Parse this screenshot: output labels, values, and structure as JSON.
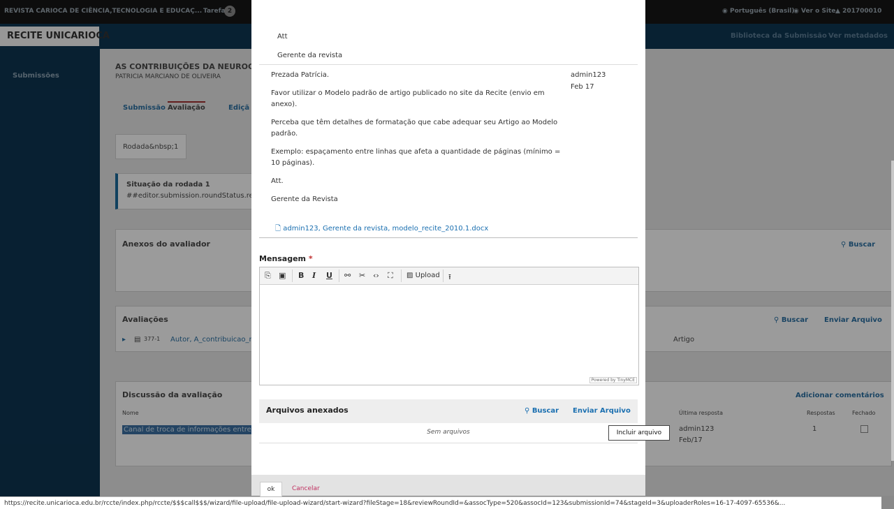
{
  "topbar": {
    "journal": "REVISTA CARIOCA DE CIÊNCIA,TECNOLOGIA E EDUCAÇ...",
    "tasks_label": "Tarefas",
    "tasks_count": "2",
    "language": "Português (Brasil)",
    "view_site": "Ver o Site",
    "user": "201700010"
  },
  "nav": {
    "library": "Biblioteca da Submissão",
    "metadata": "Ver metadados"
  },
  "logo": {
    "text": "RECITE UNICARIOCA"
  },
  "sidebar": {
    "submissions": "Submissões"
  },
  "background": {
    "title": "AS CONTRIBUIÇÕES DA NEUROCIÊN",
    "author": "PATRICIA MARCIANO DE OLIVEIRA",
    "tabs": [
      "Submissão",
      "Avaliação",
      "Ediçã"
    ],
    "round_tab": "Rodada&nbsp;1",
    "round_status_title": "Situação da rodada 1",
    "round_status_text": "##editor.submission.roundStatus.revi",
    "reviewer_attachments": "Anexos do avaliador",
    "search": "Buscar",
    "reviews": "Avaliações",
    "reviews_search": "Buscar",
    "reviews_upload": "Enviar Arquivo",
    "file_id": "377-1",
    "file_name": "Autor, A_contribuicao_ne",
    "file_type": "Artigo",
    "discussion": "Discussão da avaliação",
    "add_comments": "Adicionar comentários",
    "col_name": "Nome",
    "col_last_reply": "Última resposta",
    "col_replies": "Respostas",
    "col_closed": "Fechado",
    "discussion_row": "Canal de troca de informações entre Au",
    "row_reply_user": "admin123",
    "row_reply_date": "Feb/17",
    "row_replies": "1"
  },
  "modal": {
    "prev_message": {
      "line1": "Att",
      "line2": "Gerente da revista"
    },
    "message": {
      "paragraphs": [
        "Prezada Patrícia.",
        "Favor utilizar o Modelo padrão de artigo publicado no site da Recite (envio em anexo).",
        "Perceba que têm detalhes de formatação que cabe adequar seu Artigo ao Modelo padrão.",
        "Exemplo: espaçamento entre linhas que afeta a quantidade de páginas (mínimo = 10 páginas).",
        "Att.",
        "Gerente da Revista"
      ],
      "author": "admin123",
      "date": "Feb 17",
      "attachment": "admin123, Gerente da revista, modelo_recite_2010.1.docx"
    },
    "field_label": "Mensagem",
    "required_mark": "*",
    "toolbar": {
      "upload": "Upload"
    },
    "powered_by": "Powered by TinyMCE",
    "attachments_title": "Arquivos anexados",
    "search": "Buscar",
    "upload_file": "Enviar Arquivo",
    "no_files": "Sem arquivos",
    "ok": "ok",
    "cancel": "Cancelar"
  },
  "tooltip": "Incluir arquivo",
  "status_url": "https://recite.unicarioca.edu.br/rccte/index.php/rccte/$$$call$$$/wizard/file-upload/file-upload-wizard/start-wizard?fileStage=18&reviewRoundId=&assocType=520&assocId=123&submissionId=74&stageId=3&uploaderRoles=16-17-4097-65536&..."
}
